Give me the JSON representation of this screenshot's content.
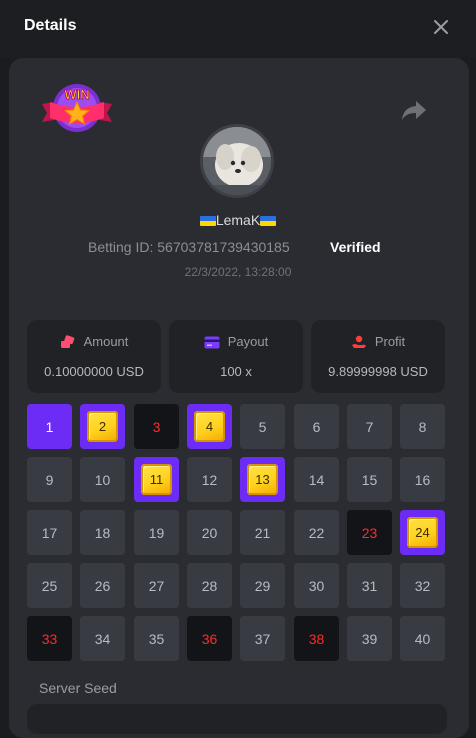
{
  "header": {
    "title": "Details"
  },
  "player": {
    "username": "LemaK",
    "betting_id_label": "Betting ID:",
    "betting_id": "56703781739430185",
    "verified_label": "Verified",
    "datetime": "22/3/2022, 13:28:00"
  },
  "badge": {
    "text": "WIN"
  },
  "stats": {
    "amount": {
      "label": "Amount",
      "value": "0.10000000 USD"
    },
    "payout": {
      "label": "Payout",
      "value": "100 x"
    },
    "profit": {
      "label": "Profit",
      "value": "9.89999998 USD"
    }
  },
  "grid": {
    "cells": [
      {
        "n": "1",
        "state": "selected"
      },
      {
        "n": "2",
        "state": "gem"
      },
      {
        "n": "3",
        "state": "red"
      },
      {
        "n": "4",
        "state": "gem"
      },
      {
        "n": "5",
        "state": "normal"
      },
      {
        "n": "6",
        "state": "normal"
      },
      {
        "n": "7",
        "state": "normal"
      },
      {
        "n": "8",
        "state": "normal"
      },
      {
        "n": "9",
        "state": "normal"
      },
      {
        "n": "10",
        "state": "normal"
      },
      {
        "n": "11",
        "state": "gem"
      },
      {
        "n": "12",
        "state": "normal"
      },
      {
        "n": "13",
        "state": "gem"
      },
      {
        "n": "14",
        "state": "normal"
      },
      {
        "n": "15",
        "state": "normal"
      },
      {
        "n": "16",
        "state": "normal"
      },
      {
        "n": "17",
        "state": "normal"
      },
      {
        "n": "18",
        "state": "normal"
      },
      {
        "n": "19",
        "state": "normal"
      },
      {
        "n": "20",
        "state": "normal"
      },
      {
        "n": "21",
        "state": "normal"
      },
      {
        "n": "22",
        "state": "normal"
      },
      {
        "n": "23",
        "state": "red"
      },
      {
        "n": "24",
        "state": "gem"
      },
      {
        "n": "25",
        "state": "normal"
      },
      {
        "n": "26",
        "state": "normal"
      },
      {
        "n": "27",
        "state": "normal"
      },
      {
        "n": "28",
        "state": "normal"
      },
      {
        "n": "29",
        "state": "normal"
      },
      {
        "n": "30",
        "state": "normal"
      },
      {
        "n": "31",
        "state": "normal"
      },
      {
        "n": "32",
        "state": "normal"
      },
      {
        "n": "33",
        "state": "red"
      },
      {
        "n": "34",
        "state": "normal"
      },
      {
        "n": "35",
        "state": "normal"
      },
      {
        "n": "36",
        "state": "red"
      },
      {
        "n": "37",
        "state": "normal"
      },
      {
        "n": "38",
        "state": "red"
      },
      {
        "n": "39",
        "state": "normal"
      },
      {
        "n": "40",
        "state": "normal"
      }
    ]
  },
  "seed": {
    "server_seed_label": "Server Seed"
  },
  "colors": {
    "background": "#1b1c20",
    "panel": "#2b2c31",
    "card": "#212226",
    "cell": "#393b42",
    "accent_purple": "#6c2cf5",
    "gem_gold": "#ffd21f",
    "mine_red": "#ff2a2a",
    "icon_pink": "#ff4e72",
    "icon_purple": "#7a3cff",
    "icon_red": "#ff3b3b"
  },
  "icons": {
    "close": "close-icon",
    "share": "share-arrow-icon",
    "amount": "coins-icon",
    "payout": "card-icon",
    "profit": "hand-coin-icon",
    "flag": "ukraine-flag-icon"
  }
}
